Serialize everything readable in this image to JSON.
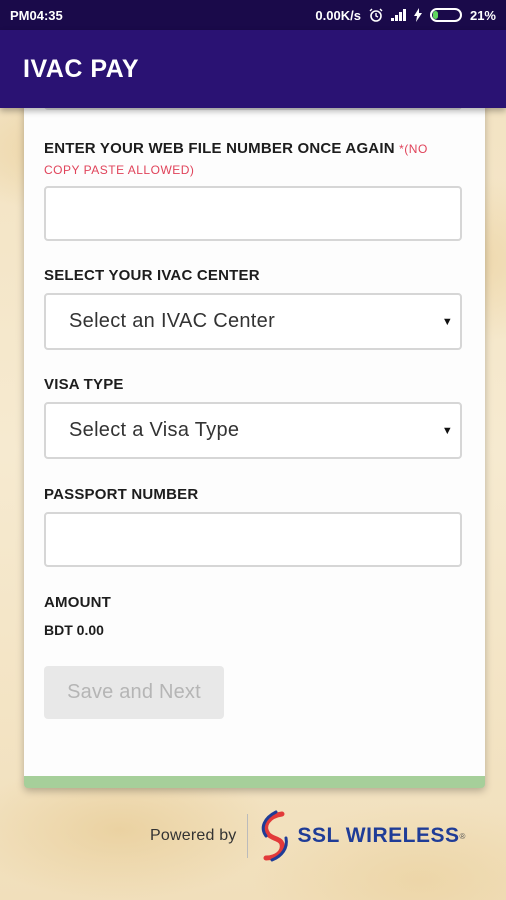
{
  "status_bar": {
    "time": "PM04:35",
    "speed": "0.00K/s",
    "battery": "21%"
  },
  "app_bar": {
    "title": "IVAC PAY"
  },
  "form": {
    "webfile_label": "ENTER YOUR WEB FILE NUMBER ONCE AGAIN",
    "webfile_note_1": "*(NO",
    "webfile_note_2": "COPY PASTE ALLOWED)",
    "webfile_value": "",
    "center_label": "SELECT YOUR IVAC CENTER",
    "center_selected": "Select an IVAC Center",
    "visa_label": "VISA TYPE",
    "visa_selected": "Select a Visa Type",
    "passport_label": "PASSPORT NUMBER",
    "passport_value": "",
    "amount_label": "AMOUNT",
    "amount_value": "BDT 0.00",
    "save_button": "Save and Next"
  },
  "footer": {
    "powered_by": "Powered by",
    "brand": "SSL WIRELESS",
    "brand_mark": "®"
  },
  "colors": {
    "app_bar": "#2a1273",
    "status_bar": "#1a0a4a",
    "note": "#e0435a",
    "brand": "#1f3c97",
    "card_accent": "#a6cf9a"
  },
  "icons": [
    "alarm-icon",
    "signal-icon",
    "charging-icon",
    "battery-icon",
    "dropdown-caret-icon",
    "ssl-logo-icon"
  ]
}
